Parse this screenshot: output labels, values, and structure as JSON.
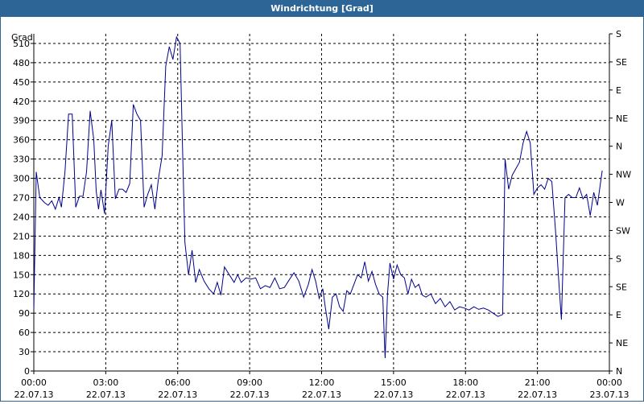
{
  "window": {
    "title": "Windrichtung [Grad]"
  },
  "chart_data": {
    "type": "line",
    "title": "Windrichtung [Grad]",
    "ylabel": "Grad",
    "xlabel": "",
    "ylim": [
      0,
      525
    ],
    "xlim_hours": [
      0,
      24
    ],
    "grid": true,
    "line_color": "#00008b",
    "y_ticks": [
      0,
      30,
      60,
      90,
      120,
      150,
      180,
      210,
      240,
      270,
      300,
      330,
      360,
      390,
      420,
      450,
      480,
      510
    ],
    "right_axis": [
      {
        "value": 0,
        "label": "N"
      },
      {
        "value": 45,
        "label": "NE"
      },
      {
        "value": 90,
        "label": "E"
      },
      {
        "value": 135,
        "label": "SE"
      },
      {
        "value": 180,
        "label": "S"
      },
      {
        "value": 225,
        "label": "SW"
      },
      {
        "value": 270,
        "label": "W"
      },
      {
        "value": 315,
        "label": "NW"
      },
      {
        "value": 360,
        "label": "N"
      },
      {
        "value": 405,
        "label": "NE"
      },
      {
        "value": 450,
        "label": "E"
      },
      {
        "value": 495,
        "label": "SE"
      },
      {
        "value": 540,
        "label": "S"
      }
    ],
    "x_ticks": [
      {
        "hour": 0,
        "time": "00:00",
        "date": "22.07.13"
      },
      {
        "hour": 3,
        "time": "03:00",
        "date": "22.07.13"
      },
      {
        "hour": 6,
        "time": "06:00",
        "date": "22.07.13"
      },
      {
        "hour": 9,
        "time": "09:00",
        "date": "22.07.13"
      },
      {
        "hour": 12,
        "time": "12:00",
        "date": "22.07.13"
      },
      {
        "hour": 15,
        "time": "15:00",
        "date": "22.07.13"
      },
      {
        "hour": 18,
        "time": "18:00",
        "date": "22.07.13"
      },
      {
        "hour": 21,
        "time": "21:00",
        "date": "22.07.13"
      },
      {
        "hour": 24,
        "time": "00:00",
        "date": "23.07.13"
      }
    ],
    "series": [
      {
        "points": [
          [
            0.0,
            95
          ],
          [
            0.1,
            310
          ],
          [
            0.25,
            270
          ],
          [
            0.45,
            262
          ],
          [
            0.6,
            258
          ],
          [
            0.75,
            265
          ],
          [
            0.9,
            252
          ],
          [
            1.05,
            270
          ],
          [
            1.15,
            255
          ],
          [
            1.3,
            310
          ],
          [
            1.45,
            400
          ],
          [
            1.6,
            400
          ],
          [
            1.75,
            255
          ],
          [
            1.9,
            272
          ],
          [
            2.05,
            272
          ],
          [
            2.2,
            310
          ],
          [
            2.35,
            405
          ],
          [
            2.5,
            360
          ],
          [
            2.6,
            280
          ],
          [
            2.7,
            252
          ],
          [
            2.8,
            282
          ],
          [
            2.95,
            245
          ],
          [
            3.1,
            350
          ],
          [
            3.25,
            390
          ],
          [
            3.4,
            268
          ],
          [
            3.55,
            283
          ],
          [
            3.7,
            283
          ],
          [
            3.85,
            278
          ],
          [
            4.0,
            292
          ],
          [
            4.15,
            415
          ],
          [
            4.3,
            400
          ],
          [
            4.45,
            390
          ],
          [
            4.6,
            255
          ],
          [
            4.75,
            275
          ],
          [
            4.9,
            290
          ],
          [
            5.05,
            252
          ],
          [
            5.2,
            300
          ],
          [
            5.35,
            335
          ],
          [
            5.5,
            475
          ],
          [
            5.65,
            505
          ],
          [
            5.8,
            485
          ],
          [
            5.95,
            520
          ],
          [
            6.1,
            510
          ],
          [
            6.2,
            350
          ],
          [
            6.3,
            200
          ],
          [
            6.45,
            150
          ],
          [
            6.6,
            188
          ],
          [
            6.75,
            138
          ],
          [
            6.9,
            158
          ],
          [
            7.1,
            140
          ],
          [
            7.3,
            128
          ],
          [
            7.5,
            120
          ],
          [
            7.65,
            138
          ],
          [
            7.8,
            118
          ],
          [
            7.95,
            162
          ],
          [
            8.15,
            150
          ],
          [
            8.35,
            138
          ],
          [
            8.5,
            150
          ],
          [
            8.65,
            138
          ],
          [
            8.85,
            145
          ],
          [
            9.05,
            143
          ],
          [
            9.25,
            145
          ],
          [
            9.45,
            128
          ],
          [
            9.65,
            133
          ],
          [
            9.85,
            130
          ],
          [
            10.05,
            145
          ],
          [
            10.25,
            128
          ],
          [
            10.45,
            130
          ],
          [
            10.65,
            142
          ],
          [
            10.85,
            153
          ],
          [
            11.05,
            140
          ],
          [
            11.25,
            115
          ],
          [
            11.45,
            135
          ],
          [
            11.6,
            158
          ],
          [
            11.75,
            140
          ],
          [
            11.9,
            113
          ],
          [
            12.05,
            128
          ],
          [
            12.15,
            100
          ],
          [
            12.3,
            65
          ],
          [
            12.45,
            115
          ],
          [
            12.6,
            120
          ],
          [
            12.75,
            100
          ],
          [
            12.9,
            93
          ],
          [
            13.05,
            125
          ],
          [
            13.2,
            120
          ],
          [
            13.35,
            135
          ],
          [
            13.5,
            150
          ],
          [
            13.65,
            145
          ],
          [
            13.8,
            170
          ],
          [
            13.95,
            140
          ],
          [
            14.1,
            155
          ],
          [
            14.25,
            135
          ],
          [
            14.4,
            120
          ],
          [
            14.55,
            115
          ],
          [
            14.65,
            20
          ],
          [
            14.75,
            120
          ],
          [
            14.85,
            168
          ],
          [
            15.0,
            143
          ],
          [
            15.15,
            165
          ],
          [
            15.3,
            150
          ],
          [
            15.45,
            145
          ],
          [
            15.6,
            120
          ],
          [
            15.75,
            143
          ],
          [
            15.9,
            130
          ],
          [
            16.05,
            135
          ],
          [
            16.2,
            118
          ],
          [
            16.35,
            115
          ],
          [
            16.55,
            120
          ],
          [
            16.75,
            105
          ],
          [
            16.95,
            113
          ],
          [
            17.15,
            100
          ],
          [
            17.35,
            108
          ],
          [
            17.55,
            95
          ],
          [
            17.75,
            100
          ],
          [
            17.95,
            98
          ],
          [
            18.15,
            95
          ],
          [
            18.35,
            100
          ],
          [
            18.55,
            96
          ],
          [
            18.75,
            98
          ],
          [
            18.95,
            95
          ],
          [
            19.15,
            90
          ],
          [
            19.35,
            85
          ],
          [
            19.55,
            88
          ],
          [
            19.65,
            330
          ],
          [
            19.8,
            283
          ],
          [
            19.95,
            305
          ],
          [
            20.1,
            315
          ],
          [
            20.25,
            325
          ],
          [
            20.4,
            355
          ],
          [
            20.55,
            373
          ],
          [
            20.7,
            355
          ],
          [
            20.85,
            275
          ],
          [
            21.0,
            285
          ],
          [
            21.15,
            290
          ],
          [
            21.3,
            283
          ],
          [
            21.45,
            300
          ],
          [
            21.6,
            295
          ],
          [
            21.75,
            220
          ],
          [
            21.9,
            135
          ],
          [
            22.0,
            80
          ],
          [
            22.15,
            270
          ],
          [
            22.3,
            275
          ],
          [
            22.45,
            270
          ],
          [
            22.6,
            270
          ],
          [
            22.75,
            285
          ],
          [
            22.9,
            268
          ],
          [
            23.05,
            275
          ],
          [
            23.2,
            242
          ],
          [
            23.35,
            278
          ],
          [
            23.5,
            258
          ],
          [
            23.7,
            312
          ]
        ]
      }
    ]
  }
}
